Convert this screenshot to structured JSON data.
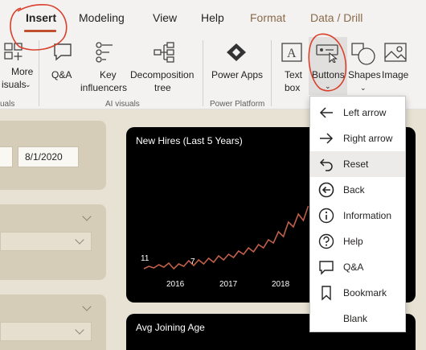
{
  "tabs": [
    {
      "label": "Insert"
    },
    {
      "label": "Modeling"
    },
    {
      "label": "View"
    },
    {
      "label": "Help"
    },
    {
      "label": "Format"
    },
    {
      "label": "Data / Drill"
    }
  ],
  "ribbon": {
    "more_visuals": {
      "line1": "More",
      "line2": "isuals"
    },
    "qa": "Q&A",
    "key_influencers": {
      "line1": "Key",
      "line2": "influencers"
    },
    "decomposition": {
      "line1": "Decomposition",
      "line2": "tree"
    },
    "power_apps": "Power Apps",
    "text_box": {
      "line1": "Text",
      "line2": "box"
    },
    "buttons": "Buttons",
    "shapes": "Shapes",
    "image": "Image",
    "group_visuals_left": "uals",
    "group_ai": "AI visuals",
    "group_power_platform": "Power Platform"
  },
  "canvas": {
    "date_value": "8/1/2020",
    "chart1": {
      "title": "New Hires (Last 5 Years)"
    },
    "chart2": {
      "title": "Avg Joining Age"
    }
  },
  "chart_data": {
    "type": "line",
    "title": "New Hires (Last 5 Years)",
    "x_ticks": [
      "2016",
      "2017",
      "2018"
    ],
    "data_labels": [
      "11",
      "7"
    ],
    "series_color": "#c0604a"
  },
  "menu": {
    "items": [
      {
        "label": "Left arrow",
        "icon": "left-arrow-icon"
      },
      {
        "label": "Right arrow",
        "icon": "right-arrow-icon"
      },
      {
        "label": "Reset",
        "icon": "reset-icon"
      },
      {
        "label": "Back",
        "icon": "back-icon"
      },
      {
        "label": "Information",
        "icon": "information-icon"
      },
      {
        "label": "Help",
        "icon": "help-icon"
      },
      {
        "label": "Q&A",
        "icon": "qa-icon"
      },
      {
        "label": "Bookmark",
        "icon": "bookmark-icon"
      },
      {
        "label": "Blank",
        "icon": ""
      }
    ]
  },
  "colors": {
    "accent": "#c1502e",
    "annotation": "#d9402b",
    "ribbon_bg": "#f3f2f1",
    "canvas_bg": "#e8e2d4",
    "chart_bg": "#000000"
  }
}
